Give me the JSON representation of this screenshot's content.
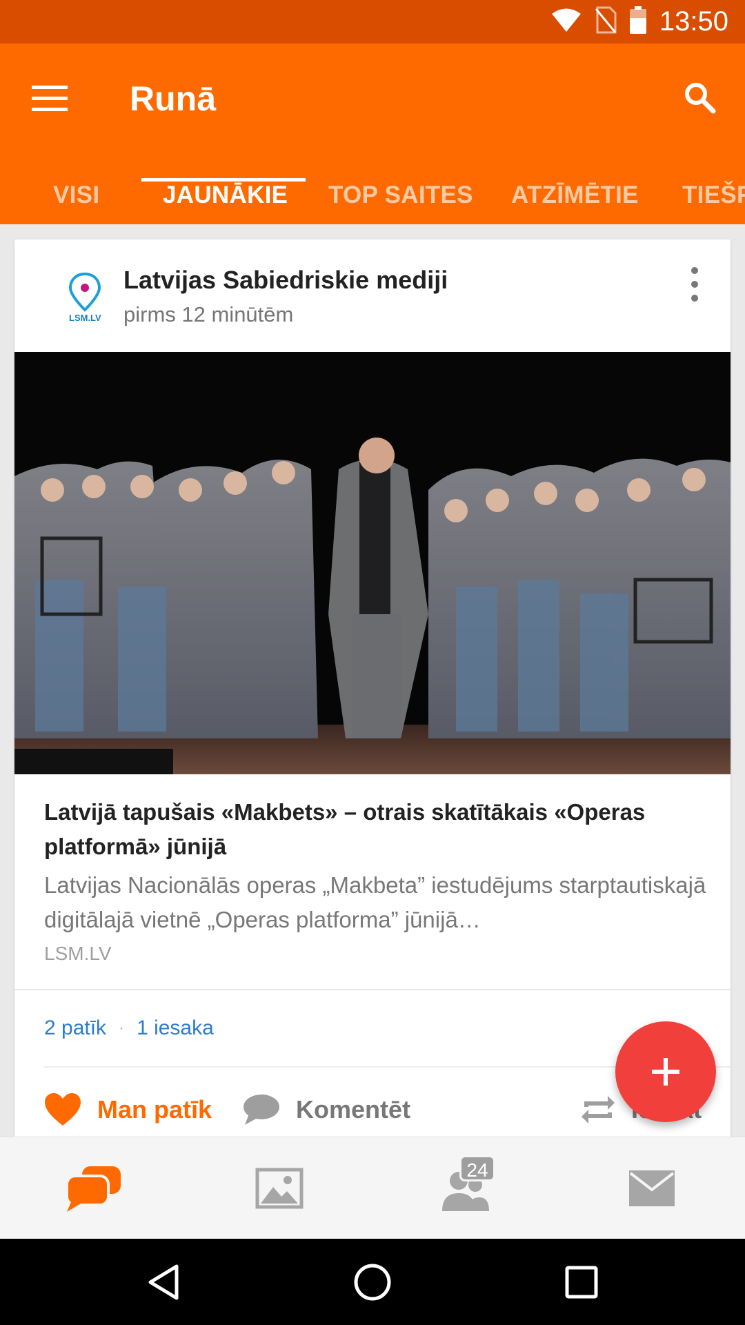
{
  "status_bar": {
    "time": "13:50"
  },
  "app_bar": {
    "title": "Runā"
  },
  "tabs": [
    {
      "label": "VISI"
    },
    {
      "label": "JAUNĀKIE"
    },
    {
      "label": "TOP SAITES"
    },
    {
      "label": "ATZĪMĒTIE"
    },
    {
      "label": "TIEŠR"
    }
  ],
  "post": {
    "source_name": "Latvijas Sabiedriskie mediji",
    "source_logo_text": "LSM.LV",
    "time": "pirms 12 minūtēm",
    "headline": "Latvijā tapušais «Makbets» – otrais skatītākais «Operas platformā» jūnijā",
    "snippet": "Latvijas Nacionālās operas „Makbeta” iestudējums starptautiskajā digitālajā vietnē „Operas platforma” jūnijā…",
    "domain": "LSM.LV",
    "likes": "2 patīk",
    "recommendations": "1 iesaka",
    "actions": {
      "like": "Man patīk",
      "comment": "Komentēt",
      "reshare": "Iesakt"
    }
  },
  "bottom_nav": {
    "badge": "24"
  },
  "colors": {
    "accent": "#ff6a00",
    "status_bar": "#d84d00",
    "fab": "#f1403c",
    "link": "#2a7bd2"
  }
}
